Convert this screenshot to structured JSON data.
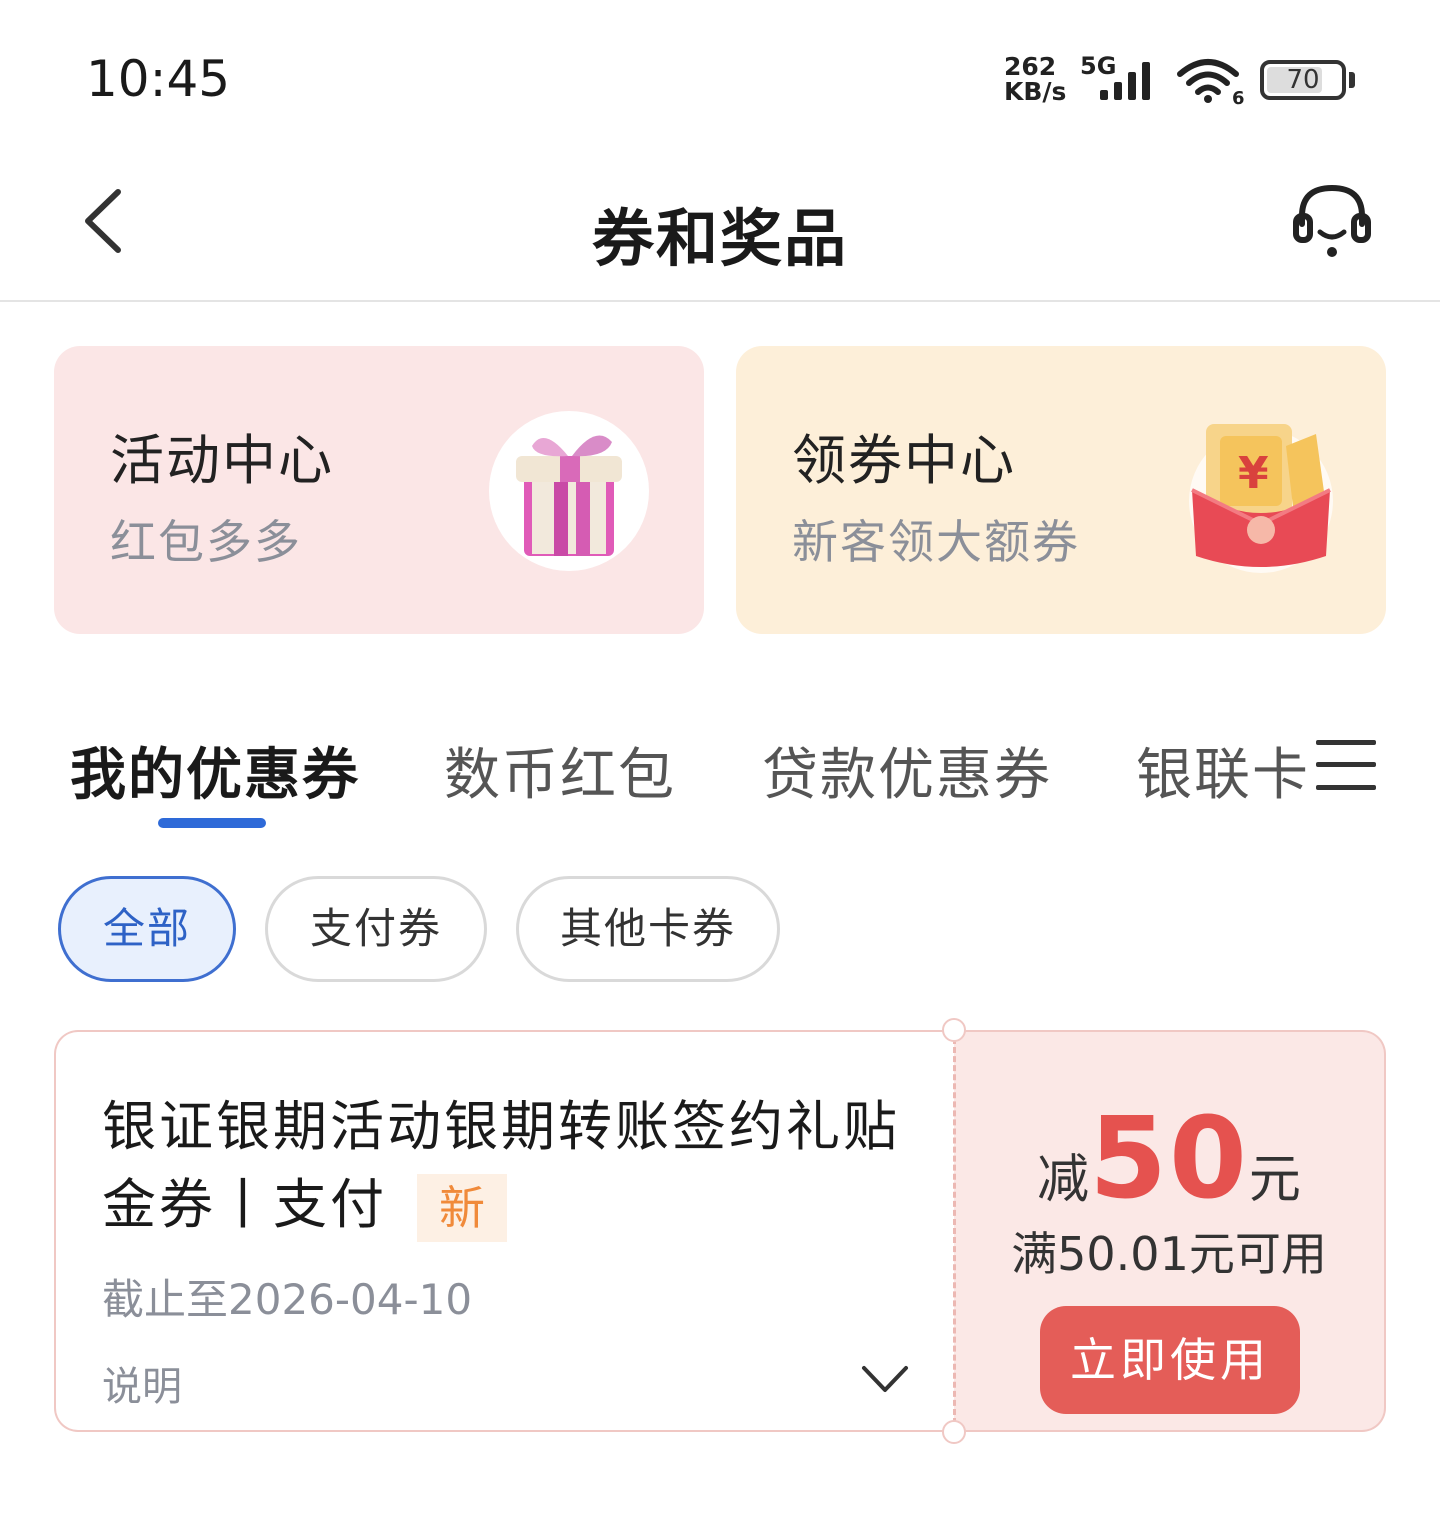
{
  "status_bar": {
    "time": "10:45",
    "net_speed_value": "262",
    "net_speed_unit": "KB/s",
    "signal_label": "5G",
    "wifi_label": "6",
    "battery": "70"
  },
  "header": {
    "title": "券和奖品",
    "back_icon": "chevron-left-icon",
    "service_icon": "headset-icon"
  },
  "promos": [
    {
      "title": "活动中心",
      "subtitle": "红包多多",
      "icon": "gift-box-icon"
    },
    {
      "title": "领券中心",
      "subtitle": "新客领大额券",
      "icon": "red-envelope-icon"
    }
  ],
  "tabs": [
    {
      "label": "我的优惠券",
      "active": true
    },
    {
      "label": "数币红包",
      "active": false
    },
    {
      "label": "贷款优惠券",
      "active": false
    },
    {
      "label": "银联卡",
      "active": false
    }
  ],
  "filters": [
    {
      "label": "全部",
      "active": true
    },
    {
      "label": "支付券",
      "active": false
    },
    {
      "label": "其他卡券",
      "active": false
    }
  ],
  "coupon": {
    "title": "银证银期活动银期转账签约礼贴金券丨支付",
    "badge": "新",
    "expiry": "截止至2026-04-10",
    "desc_label": "说明",
    "amount_prefix": "减",
    "amount_value": "50",
    "amount_unit": "元",
    "condition": "满50.01元可用",
    "button": "立即使用"
  },
  "colors": {
    "accent_blue": "#2e6ad8",
    "coupon_red": "#e5524f",
    "button_red": "#e45d58",
    "badge_orange": "#f08a3a",
    "activity_bg": "#fbe6e6",
    "coupon_center_bg": "#fdefd9"
  }
}
